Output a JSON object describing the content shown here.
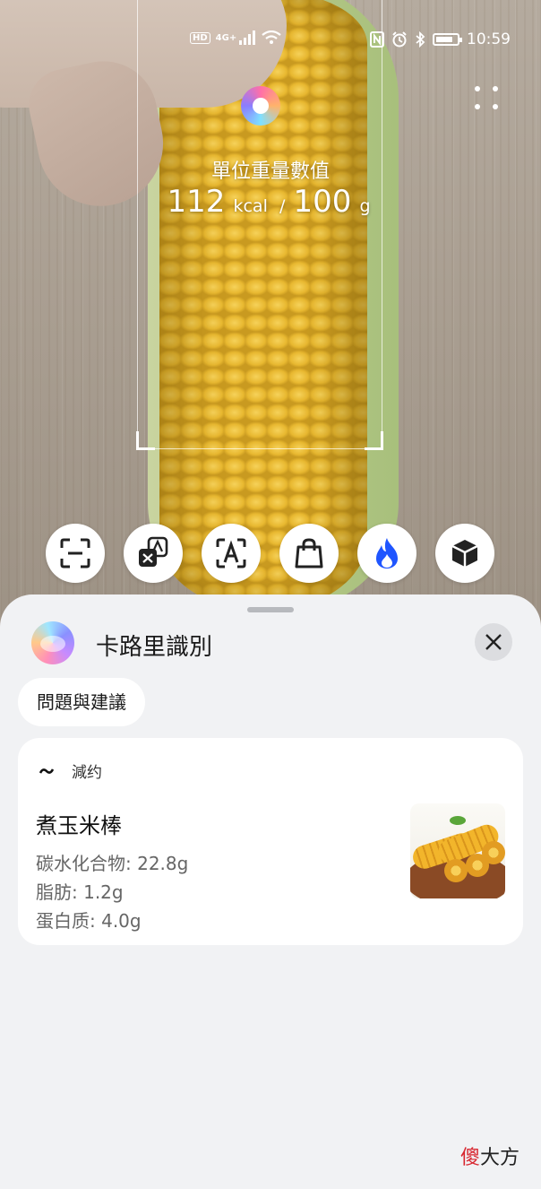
{
  "status_bar": {
    "network_badge": "HD",
    "signal_label": "4G+",
    "time": "10:59"
  },
  "scanner": {
    "unit_label": "單位重量數值",
    "calories_value": "112",
    "calories_unit": "kcal",
    "separator": "/",
    "weight_value": "100",
    "weight_unit": "g"
  },
  "tools": [
    {
      "name": "scan",
      "icon": "scan-frame-icon"
    },
    {
      "name": "translate",
      "icon": "translate-icon"
    },
    {
      "name": "text",
      "icon": "text-recognition-icon"
    },
    {
      "name": "shopping",
      "icon": "shopping-bag-icon"
    },
    {
      "name": "calorie",
      "icon": "flame-icon",
      "active": true,
      "color": "#1f55ff"
    },
    {
      "name": "object",
      "icon": "box-icon"
    }
  ],
  "sheet": {
    "title": "卡路里識別",
    "chip_label": "問題與建議",
    "card": {
      "tag": "減约",
      "food_name": "煮玉米棒",
      "carbs": "碳水化合物: 22.8g",
      "fat": "脂肪: 1.2g",
      "protein": "蛋白质: 4.0g"
    }
  },
  "watermark": {
    "red_part": "傻",
    "black_part": "大方"
  }
}
